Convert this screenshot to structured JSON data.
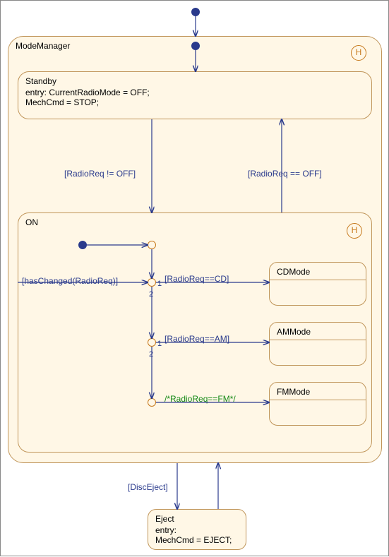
{
  "outer": {
    "title": "ModeManager",
    "history": "H"
  },
  "standby": {
    "title": "Standby",
    "line1": "entry: CurrentRadioMode = OFF;",
    "line2": "MechCmd = STOP;"
  },
  "on": {
    "title": "ON",
    "history": "H"
  },
  "modes": {
    "cd": "CDMode",
    "am": "AMMode",
    "fm": "FMMode"
  },
  "eject": {
    "title": "Eject",
    "line1": "entry:",
    "line2": "MechCmd = EJECT;"
  },
  "transitions": {
    "to_on": "[RadioReq != OFF]",
    "to_standby": "[RadioReq == OFF]",
    "hasChanged": "[hasChanged(RadioReq)]",
    "cd": "[RadioReq==CD]",
    "am": "[RadioReq==AM]",
    "fm": "/*RadioReq==FM*/",
    "discEject": "[DiscEject]"
  },
  "priorities": {
    "j1p1": "1",
    "j1p2": "2",
    "j2p1": "1",
    "j2p2": "2"
  }
}
